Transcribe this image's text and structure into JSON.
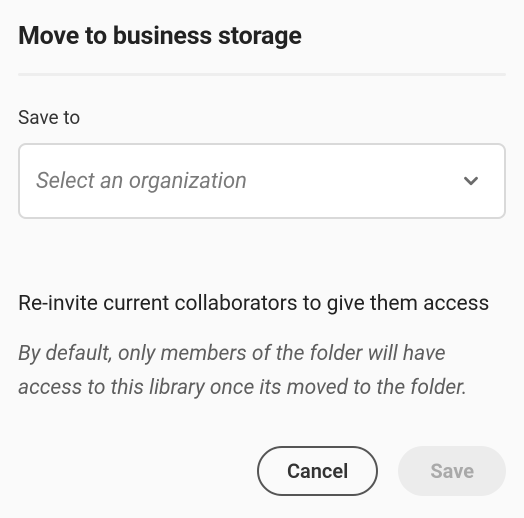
{
  "dialog": {
    "title": "Move to business storage",
    "saveto_label": "Save to",
    "select_placeholder": "Select an organization",
    "reinvite_heading": "Re-invite current collaborators to give them access",
    "reinvite_description": "By default, only members of the folder will have access to this library once its moved to the folder."
  },
  "actions": {
    "cancel_label": "Cancel",
    "save_label": "Save"
  }
}
